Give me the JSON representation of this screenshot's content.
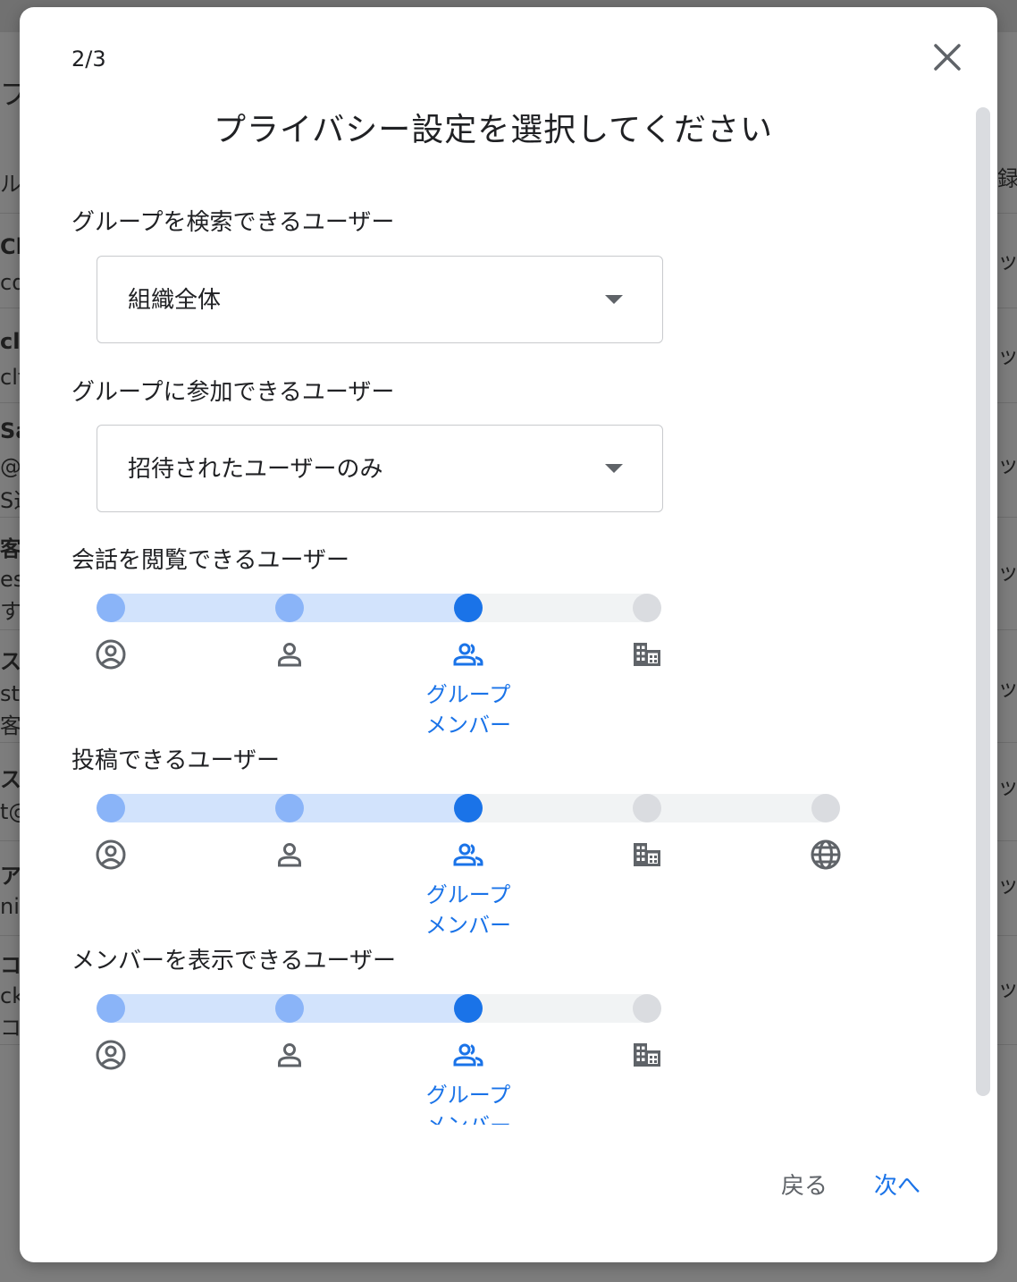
{
  "background": {
    "edge_text": [
      "プ",
      "ル",
      "Cl",
      "cdc",
      "cl",
      "clt",
      "Sa",
      "@",
      "S選",
      "客",
      "est",
      "すよ",
      "ス",
      "sto",
      "客様",
      "ス",
      "t@",
      "ア",
      "ni-",
      "コ",
      "ck",
      "コソ",
      "録",
      "ッ",
      "ッ",
      "ッ",
      "ッ",
      "ッ",
      "ッ",
      "ッ",
      "ッ"
    ]
  },
  "dialog": {
    "step": "2/3",
    "title": "プライバシー設定を選択してください",
    "close_icon": "close-icon",
    "sections": {
      "search": {
        "label": "グループを検索できるユーザー",
        "value": "組織全体"
      },
      "join": {
        "label": "グループに参加できるユーザー",
        "value": "招待されたユーザーのみ"
      },
      "view": {
        "label": "会話を閲覧できるユーザー",
        "options": [
          "group-owner-icon",
          "person-icon",
          "group-icon",
          "domain-icon"
        ],
        "selected_index": 2,
        "selected_caption_1": "グループ",
        "selected_caption_2": "メンバー"
      },
      "post": {
        "label": "投稿できるユーザー",
        "options": [
          "group-owner-icon",
          "person-icon",
          "group-icon",
          "domain-icon",
          "globe-icon"
        ],
        "selected_index": 2,
        "selected_caption_1": "グループ",
        "selected_caption_2": "メンバー"
      },
      "members": {
        "label": "メンバーを表示できるユーザー",
        "options": [
          "group-owner-icon",
          "person-icon",
          "group-icon",
          "domain-icon"
        ],
        "selected_index": 2,
        "selected_caption_1": "グループ",
        "selected_caption_2": "メンバー"
      }
    },
    "footer": {
      "back": "戻る",
      "next": "次へ"
    }
  },
  "colors": {
    "accent": "#1a73e8",
    "track_fill": "#d2e3fc",
    "past_dot": "#8ab4f8",
    "inactive": "#dadce0"
  }
}
